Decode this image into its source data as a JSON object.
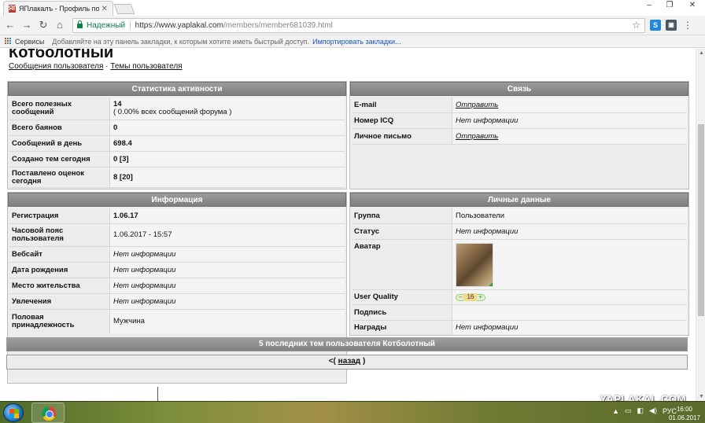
{
  "browser": {
    "tab_title": "ЯПлакалъ - Профиль по",
    "tab_favicon": "ЯП",
    "secure_label": "Надежный",
    "url_host": "https://www.yaplakal.com",
    "url_path": "/members/member681039.html",
    "bookmarks": {
      "services": "Сервисы",
      "hint": "Добавляйте на эту панель закладки, к которым хотите иметь быстрый доступ.",
      "import": "Импортировать закладки..."
    }
  },
  "profile": {
    "username": "Котболотный",
    "links": {
      "messages": "Сообщения пользователя",
      "separator": "·",
      "topics": "Темы пользователя"
    }
  },
  "activity": {
    "title": "Статистика активности",
    "rows": [
      {
        "label": "Всего полезных сообщений",
        "value": "14",
        "value2": "( 0.00% всех сообщений форума )"
      },
      {
        "label": "Всего баянов",
        "value": "0"
      },
      {
        "label": "Сообщений в день",
        "value": "698.4"
      },
      {
        "label": "Создано тем сегодня",
        "value": "0 [3]"
      },
      {
        "label": "Поставлено оценок сегодня",
        "value": "8 [20]"
      }
    ]
  },
  "contact": {
    "title": "Связь",
    "rows": [
      {
        "label": "E-mail",
        "value": "Отправить"
      },
      {
        "label": "Номер ICQ",
        "value": "Нет информации"
      },
      {
        "label": "Личное письмо",
        "value": "Отправить"
      }
    ]
  },
  "info": {
    "title": "Информация",
    "rows": [
      {
        "label": "Регистрация",
        "value": "1.06.17"
      },
      {
        "label": "Часовой пояс пользователя",
        "value": "1.06.2017 - 15:57"
      },
      {
        "label": "Вебсайт",
        "value": "Нет информации"
      },
      {
        "label": "Дата рождения",
        "value": "Нет информации"
      },
      {
        "label": "Место жительства",
        "value": "Нет информации"
      },
      {
        "label": "Увлечения",
        "value": "Нет информации"
      },
      {
        "label": "Половая принадлежность",
        "value": "Мужчина"
      }
    ]
  },
  "personal": {
    "title": "Личные данные",
    "rows": [
      {
        "label": "Группа",
        "value": "Пользователи"
      },
      {
        "label": "Статус",
        "value": "Нет информации"
      },
      {
        "label": "Аватар",
        "value": ""
      },
      {
        "label": "User Quality",
        "minus": "–",
        "quality": "16",
        "plus": "+"
      },
      {
        "label": "Подпись",
        "value": ""
      },
      {
        "label": "Награды",
        "value": "Нет информации"
      }
    ]
  },
  "recent_topics_bar": "5 последних тем пользователя Котболотный",
  "back": {
    "left": "<(",
    "link": "назад",
    "right": ")"
  },
  "watermark": "YAPLAKAL.COM",
  "taskbar": {
    "lang": "РУС",
    "time": "16:00",
    "date": "01.06.2017"
  }
}
